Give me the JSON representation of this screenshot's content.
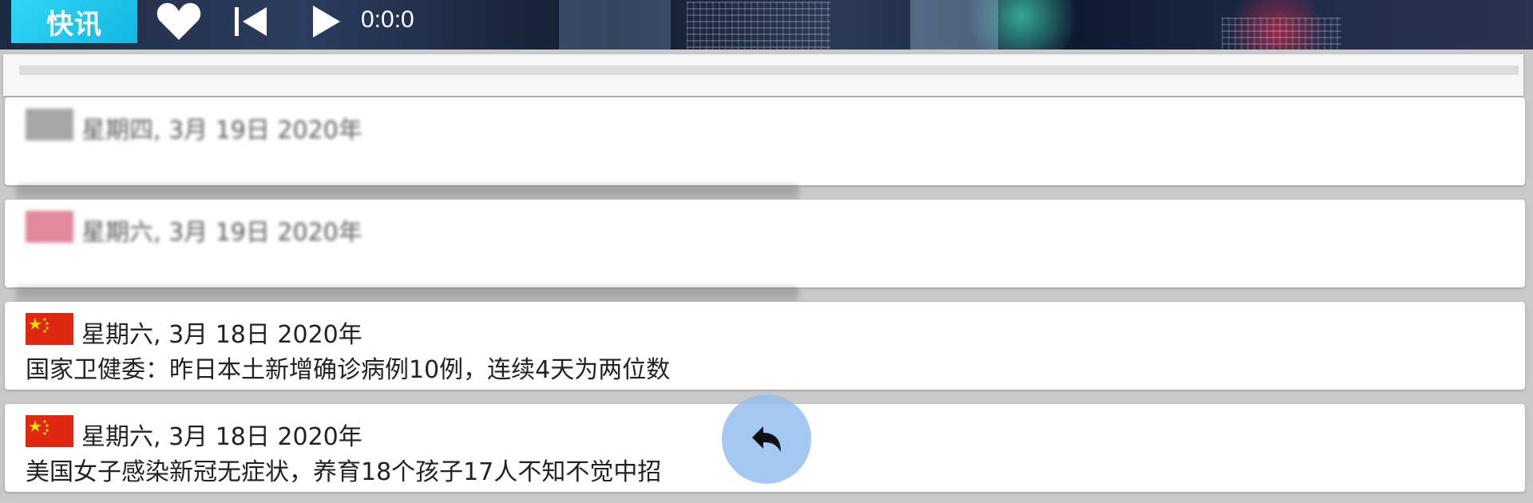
{
  "header": {
    "logo_text": "快讯",
    "icons": [
      "heart-icon",
      "skip-previous-icon",
      "play-icon"
    ],
    "time": "0:0:0"
  },
  "player": {
    "progress": 0
  },
  "news": [
    {
      "date": "星期四, 3月 19日 2020年",
      "headline": "",
      "flag": "china-flag-icon",
      "state": "blurred"
    },
    {
      "date": "星期六, 3月 19日 2020年",
      "headline": "",
      "flag": "flag-icon",
      "state": "blurred"
    },
    {
      "date": "星期六, 3月 18日 2020年",
      "headline": "国家卫健委：昨日本土新增确诊病例10例，连续4天为两位数",
      "flag": "china-flag-icon",
      "state": "normal"
    },
    {
      "date": "星期六, 3月 18日 2020年",
      "headline": "美国女子感染新冠无症状，养育18个孩子17人不知不觉中招",
      "flag": "china-flag-icon",
      "state": "normal"
    }
  ],
  "fab": {
    "icon": "reply-icon"
  },
  "colors": {
    "accent": "#2fd7f5",
    "flag_red": "#de2910",
    "fab": "#94bef0"
  }
}
